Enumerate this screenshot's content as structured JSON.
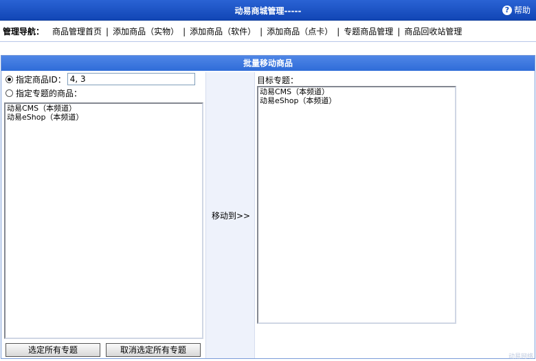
{
  "header": {
    "title": "动易商城管理-----",
    "help_label": "帮助",
    "help_icon": "?"
  },
  "nav": {
    "label": "管理导航：",
    "links": [
      "商品管理首页",
      "添加商品（实物）",
      "添加商品（软件）",
      "添加商品（点卡）",
      "专题商品管理",
      "商品回收站管理"
    ],
    "separator": "|"
  },
  "panel": {
    "title": "批量移动商品",
    "radio_id_label": "指定商品ID：",
    "id_value": "4, 3",
    "radio_special_label": "指定专题的商品：",
    "source_list": [
      "动易CMS（本频道）",
      "动易eShop（本频道）"
    ],
    "move_label": "移动到>>",
    "target_label": "目标专题：",
    "target_list": [
      "动易CMS（本频道）",
      "动易eShop（本频道）"
    ],
    "select_all_label": "选定所有专题",
    "cancel_all_label": "取消选定所有专题"
  },
  "watermark": "动易网络"
}
